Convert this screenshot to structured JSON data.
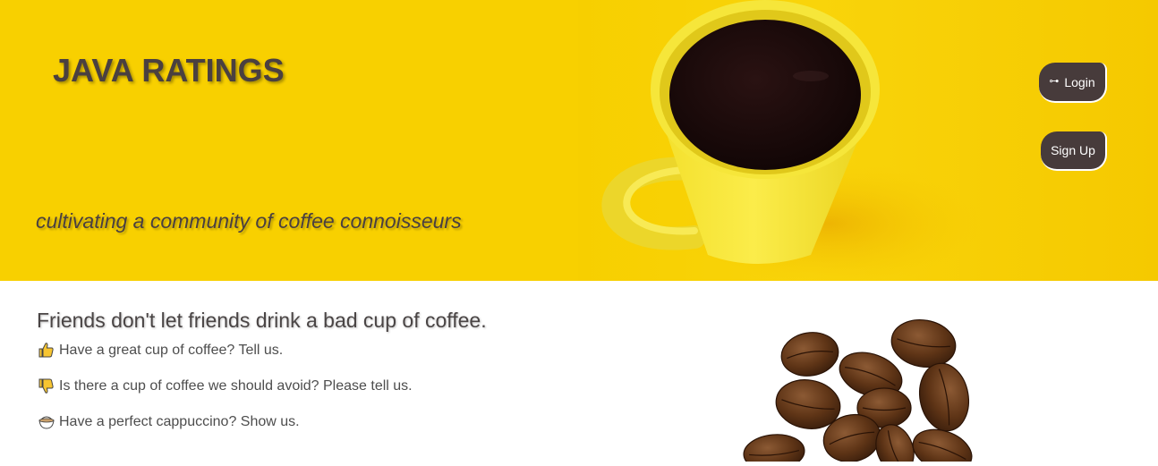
{
  "header": {
    "brand": "JAVA RATINGS",
    "tagline": "cultivating a community of coffee connoisseurs",
    "login_icon": "key-icon",
    "login_label": "Login",
    "signup_label": "Sign Up"
  },
  "main": {
    "slogan": "Friends don't let friends drink a bad cup of coffee.",
    "features": [
      {
        "icon": "thumbs-up-icon",
        "text": "Have a great cup of coffee? Tell us."
      },
      {
        "icon": "thumbs-down-icon",
        "text": "Is there a cup of coffee we should avoid? Please tell us."
      },
      {
        "icon": "cappuccino-icon",
        "text": "Have a perfect cappuccino? Show us."
      }
    ]
  },
  "colors": {
    "hero_yellow": "#f8d000",
    "button_bg": "#473b3b",
    "text_dark": "#4a4040"
  }
}
